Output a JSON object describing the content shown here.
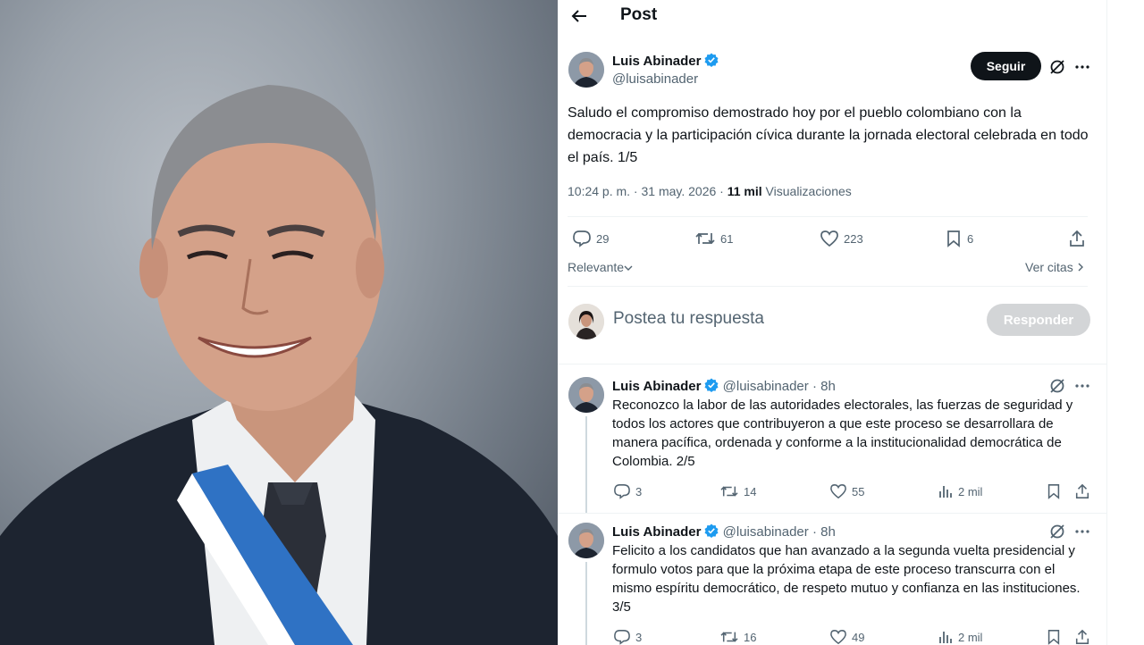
{
  "page": {
    "title": "Post"
  },
  "main_post": {
    "author_name": "Luis Abinader",
    "author_handle": "@luisabinader",
    "follow_label": "Seguir",
    "text": "Saludo el compromiso demostrado hoy por el pueblo colombiano con la democracia y la participación cívica durante la jornada electoral celebrada en todo el país. 1/5",
    "time": "10:24 p. m. · 31 may. 2026 ·",
    "views_count": "11 mil",
    "views_label": "Visualizaciones",
    "replies": "29",
    "reposts": "61",
    "likes": "223",
    "bookmarks": "6",
    "sort_label": "Relevante",
    "quotes_label": "Ver citas"
  },
  "reply_box": {
    "placeholder": "Postea tu respuesta",
    "button_label": "Responder"
  },
  "thread": [
    {
      "author_name": "Luis Abinader",
      "author_handle": "@luisabinader",
      "age": "· 8h",
      "text": "Reconozco la labor de las autoridades electorales, las fuerzas de seguridad y todos los actores que contribuyeron a que este proceso se desarrollara de manera pacífica, ordenada y conforme a la institucionalidad democrática de Colombia. 2/5",
      "replies": "3",
      "reposts": "14",
      "likes": "55",
      "views": "2 mil"
    },
    {
      "author_name": "Luis Abinader",
      "author_handle": "@luisabinader",
      "age": "· 8h",
      "text": "Felicito a los candidatos que han avanzado a la segunda vuelta presidencial y formulo votos para que la próxima etapa de este proceso transcurra con el mismo espíritu democrático, de respeto mutuo y confianza en las instituciones. 3/5",
      "replies": "3",
      "reposts": "16",
      "likes": "49",
      "views": "2 mil"
    }
  ],
  "icons": {
    "back": "back-arrow-icon",
    "verified": "verified-badge-icon",
    "grok": "grok-icon",
    "more": "more-icon",
    "reply": "reply-icon",
    "repost": "repost-icon",
    "like": "like-icon",
    "bookmark": "bookmark-icon",
    "share": "share-icon",
    "views": "views-icon"
  },
  "colors": {
    "text": "#0f1419",
    "muted": "#536471",
    "verified": "#1d9bf0",
    "divider": "#eff3f4"
  }
}
